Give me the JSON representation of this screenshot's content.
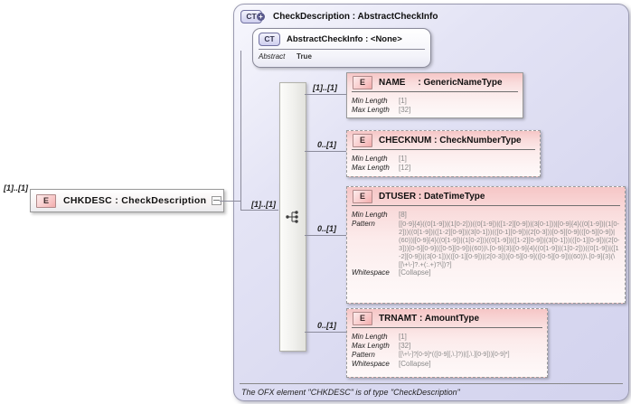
{
  "icons": {
    "element_icon": "E",
    "complex_type_icon": "CT",
    "plus_icon": "+"
  },
  "diagram": {
    "source": {
      "cardinality": "[1]..[1]",
      "title": "CHKDESC : CheckDescription"
    },
    "complex_type": {
      "title": "CheckDescription : AbstractCheckInfo",
      "base": {
        "title": "AbstractCheckInfo : <None>",
        "facets": [
          {
            "name": "Abstract",
            "value": "True"
          }
        ]
      },
      "sequence": {
        "cardinality": "[1]..[1]"
      },
      "elements": [
        {
          "cardinality": "[1]..[1]",
          "title": "NAME     : GenericNameType",
          "facets": [
            {
              "name": "Min Length",
              "value": "[1]"
            },
            {
              "name": "Max Length",
              "value": "[32]"
            }
          ]
        },
        {
          "cardinality": "0..[1]",
          "title": "CHECKNUM : CheckNumberType",
          "facets": [
            {
              "name": "Min Length",
              "value": "[1]"
            },
            {
              "name": "Max Length",
              "value": "[12]"
            }
          ]
        },
        {
          "cardinality": "0..[1]",
          "title": "DTUSER : DateTimeType",
          "facets": [
            {
              "name": "Min Length",
              "value": "[8]"
            },
            {
              "name": "Pattern",
              "value": "[[0-9]{4}((0[1-9])|(1[0-2]))((0[1-9])|([1-2][0-9])|(3[0-1]))|[0-9]{4}((0[1-9])|(1[0-2]))((0[1-9])|([1-2][0-9])|(3[0-1]))(([0-1][0-9])|(2[0-3]))[0-5][0-9](([0-5][0-9])|(60))|[0-9]{4}((0[1-9])|(1[0-2]))((0[1-9])|([1-2][0-9])|(3[0-1]))(([0-1][0-9])|(2[0-3]))[0-5][0-9](([0-5][0-9])|(60))\\.[0-9]{3}|[0-9]{4}((0[1-9])|(1[0-2]))((0[1-9])|([1-2][0-9])|(3[0-1]))(([0-1][0-9])|(2[0-3]))[0-5][0-9](([0-5][0-9])|(60))\\.[0-9]{3}(\\[[\\+\\-]?.+(:.+)?\\])?]"
            },
            {
              "name": "Whitespace",
              "value": "[Collapse]"
            }
          ]
        },
        {
          "cardinality": "0..[1]",
          "title": "TRNAMT : AmountType",
          "facets": [
            {
              "name": "Min Length",
              "value": "[1]"
            },
            {
              "name": "Max Length",
              "value": "[32]"
            },
            {
              "name": "Pattern",
              "value": "[[\\+\\-]?[0-9]*(([0-9][,\\.]?)|([,\\.][0-9]))[0-9]*]"
            },
            {
              "name": "Whitespace",
              "value": "[Collapse]"
            }
          ]
        }
      ],
      "footnote": "The OFX element \"CHKDESC\" is of type \"CheckDescription\""
    }
  }
}
